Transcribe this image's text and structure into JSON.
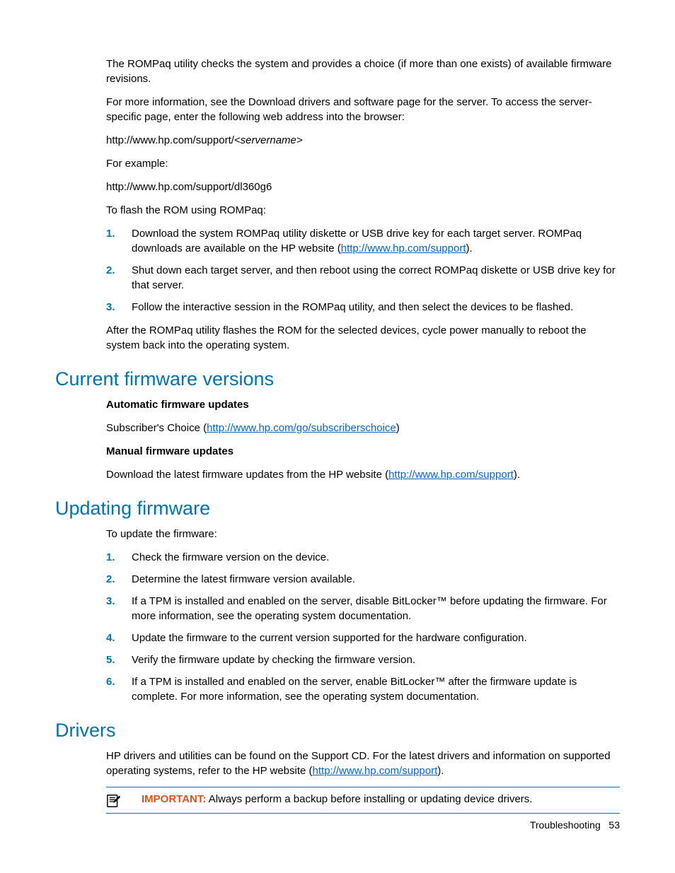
{
  "intro": {
    "p1": "The ROMPaq utility checks the system and provides a choice (if more than one exists) of available firmware revisions.",
    "p2": "For more information, see the Download drivers and software page for the server. To access the server-specific page, enter the following web address into the browser:",
    "url_template_prefix": "http://www.hp.com/support/",
    "url_template_suffix": "<servername>",
    "for_example": "For example:",
    "url_example": "http://www.hp.com/support/dl360g6",
    "flash_intro": "To flash the ROM using ROMPaq:",
    "steps": {
      "s1_a": "Download the system ROMPaq utility diskette or USB drive key for each target server. ROMPaq downloads are available on the HP website (",
      "s1_link": "http://www.hp.com/support",
      "s1_b": ").",
      "s2": "Shut down each target server, and then reboot using the correct ROMPaq diskette or USB drive key for that server.",
      "s3": "Follow the interactive session in the ROMPaq utility, and then select the devices to be flashed."
    },
    "after": "After the ROMPaq utility flashes the ROM for the selected devices, cycle power manually to reboot the system back into the operating system."
  },
  "current_firmware": {
    "heading": "Current firmware versions",
    "auto_label": "Automatic firmware updates",
    "auto_text_a": "Subscriber's Choice (",
    "auto_link": "http://www.hp.com/go/subscriberschoice",
    "auto_text_b": ")",
    "manual_label": "Manual firmware updates",
    "manual_text_a": "Download the latest firmware updates from the HP website (",
    "manual_link": "http://www.hp.com/support",
    "manual_text_b": ")."
  },
  "updating_firmware": {
    "heading": "Updating firmware",
    "intro": "To update the firmware:",
    "steps": {
      "s1": "Check the firmware version on the device.",
      "s2": "Determine the latest firmware version available.",
      "s3": "If a TPM is installed and enabled on the server, disable BitLocker™ before updating the firmware. For more information, see the operating system documentation.",
      "s4": "Update the firmware to the current version supported for the hardware configuration.",
      "s5": "Verify the firmware update by checking the firmware version.",
      "s6": "If a TPM is installed and enabled on the server, enable BitLocker™ after the firmware update is complete. For more information, see the operating system documentation."
    }
  },
  "drivers": {
    "heading": "Drivers",
    "text_a": "HP drivers and utilities can be found on the Support CD. For the latest drivers and information on supported operating systems, refer to the HP website (",
    "link": "http://www.hp.com/support",
    "text_b": ").",
    "important_label": "IMPORTANT:",
    "important_text": "  Always perform a backup before installing or updating device drivers."
  },
  "footer": {
    "section": "Troubleshooting",
    "page": "53"
  }
}
